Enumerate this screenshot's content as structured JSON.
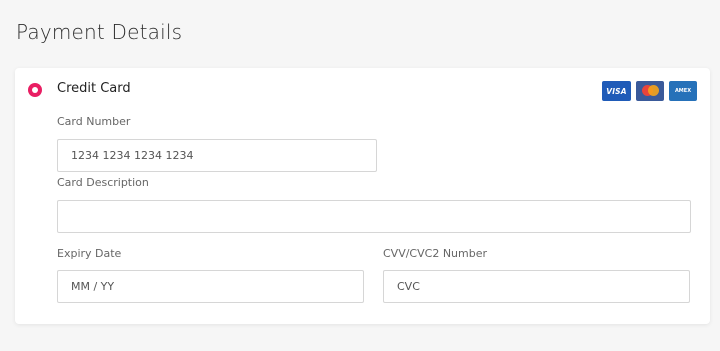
{
  "page": {
    "title": "Payment Details"
  },
  "payment_method": {
    "label": "Credit Card",
    "selected": true,
    "brands": [
      {
        "name": "VISA",
        "icon": "visa-icon"
      },
      {
        "name": "",
        "icon": "mastercard-icon"
      },
      {
        "name": "AMEX",
        "icon": "amex-icon"
      }
    ]
  },
  "form": {
    "card_number": {
      "label": "Card Number",
      "placeholder": "1234 1234 1234 1234",
      "value": ""
    },
    "card_description": {
      "label": "Card Description",
      "placeholder": "",
      "value": ""
    },
    "expiry_date": {
      "label": "Expiry Date",
      "placeholder": "MM / YY",
      "value": ""
    },
    "cvv": {
      "label": "CVV/CVC2 Number",
      "placeholder": "CVC",
      "value": ""
    }
  },
  "colors": {
    "accent": "#e91e63",
    "visa": "#1f5bb8",
    "mastercard_bg": "#3a5a9a",
    "amex": "#2671b9"
  }
}
